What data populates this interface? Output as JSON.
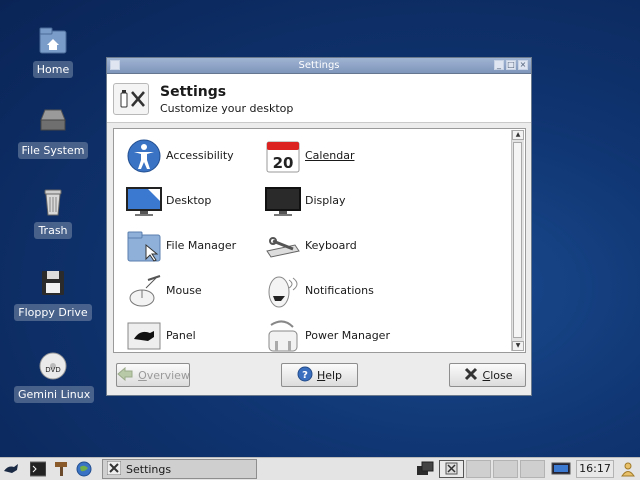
{
  "desktop": {
    "icons": [
      {
        "label": "Home",
        "icon": "home-icon"
      },
      {
        "label": "File System",
        "icon": "drive-icon"
      },
      {
        "label": "Trash",
        "icon": "trash-icon"
      },
      {
        "label": "Floppy Drive",
        "icon": "floppy-icon"
      },
      {
        "label": "Gemini Linux",
        "icon": "dvd-icon",
        "badge": "DVD"
      }
    ]
  },
  "window": {
    "title": "Settings",
    "header": {
      "title": "Settings",
      "subtitle": "Customize your desktop"
    },
    "items": [
      {
        "label": "Accessibility",
        "icon": "accessibility-icon"
      },
      {
        "label": "Calendar",
        "icon": "calendar-icon",
        "day": "20",
        "selected": true
      },
      {
        "label": "Desktop",
        "icon": "desktop-icon"
      },
      {
        "label": "Display",
        "icon": "display-icon"
      },
      {
        "label": "File Manager",
        "icon": "file-manager-icon"
      },
      {
        "label": "Keyboard",
        "icon": "keyboard-icon"
      },
      {
        "label": "Mouse",
        "icon": "mouse-icon"
      },
      {
        "label": "Notifications",
        "icon": "notifications-icon"
      },
      {
        "label": "Panel",
        "icon": "panel-icon"
      },
      {
        "label": "Power Manager",
        "icon": "power-manager-icon"
      }
    ],
    "buttons": {
      "overview": {
        "mnemonic": "O",
        "rest": "verview",
        "enabled": false
      },
      "help": {
        "mnemonic": "H",
        "rest": "elp"
      },
      "close": {
        "mnemonic": "C",
        "rest": "lose"
      }
    }
  },
  "taskbar": {
    "task": "Settings",
    "clock": "16:17"
  },
  "colors": {
    "accent": "#7f96bb",
    "desktop": "#0f3470"
  }
}
